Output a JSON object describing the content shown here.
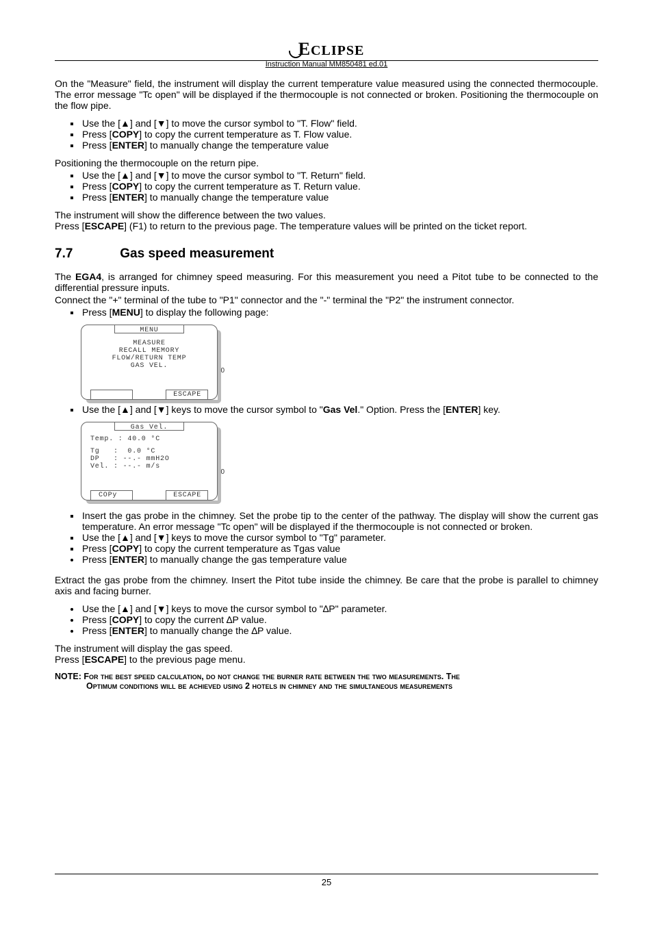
{
  "header": {
    "brand": "ECLIPSE",
    "manual_line": "Instruction Manual MM850481 ed.01"
  },
  "intro_para": "On the \"Measure\" field, the instrument will display the current temperature value measured using the connected thermocouple. The error message \"Tc open\" will be displayed if the thermocouple is not connected or broken. Positioning the thermocouple on the flow pipe.",
  "flow_list": [
    "Use the [▲] and [▼] to move the cursor symbol to \"T. Flow\" field.",
    "Press [COPY] to copy the current temperature as T. Flow value.",
    "Press [ENTER] to manually change the temperature value"
  ],
  "return_intro": "Positioning the thermocouple on the return pipe.",
  "return_list": [
    "Use the [▲] and [▼] to move the cursor symbol to \"T. Return\" field.",
    "Press [COPY] to copy the current temperature as T. Return value.",
    "Press [ENTER] to manually change the temperature value"
  ],
  "diff_para1": "The instrument will show the difference between the two values.",
  "diff_para2": "Press [ESCAPE] (F1) to return to the previous page. The temperature values will be printed on the ticket report.",
  "section": {
    "num": "7.7",
    "title": "Gas speed measurement"
  },
  "ega_para1": "The EGA4, is arranged for chimney speed measuring. For this measurement you need a Pitot tube to be connected to the differential pressure inputs.",
  "ega_para2": "Connect the \"+\" terminal of the tube to \"P1\" connector and the \"-\" terminal the \"P2\" the instrument connector.",
  "menu_prompt": "Press [MENU] to display the following page:",
  "lcd1": {
    "title": "MENU",
    "l1": "MEASURE",
    "l2": "RECALL MEMORY",
    "l3": "FLOW/RETURN TEMP",
    "l4": "GAS VEL.",
    "btn_right": "ESCAPE",
    "side": "0"
  },
  "gasvel_prompt_pre": "Use the [▲] and [▼] keys to move the cursor symbol to \"",
  "gasvel_prompt_bold": "Gas Vel",
  "gasvel_prompt_post": ".\" Option. Press the [ENTER] key.",
  "lcd2": {
    "title": "Gas Vel.",
    "l1": "Temp. : 40.0 °C",
    "l2": "Tg   :  0.0 °C",
    "l3": "DP   : --.- mmH2O",
    "l4": "Vel. : --.- m/s",
    "btn_left": "COPy",
    "btn_right": "ESCAPE",
    "side": "0"
  },
  "probe_list_sq": [
    "Insert the gas probe in the chimney. Set the probe tip to the center of the pathway. The display will show the current gas temperature. An error message \"Tc open\" will be displayed if the thermocouple is not connected or broken.",
    "Use the [▲] and [▼] keys to move the cursor symbol to \"Tg\" parameter.",
    "Press [COPY] to copy the current temperature as Tgas value"
  ],
  "probe_list_dot1": [
    "Press [ENTER] to manually change the gas temperature value"
  ],
  "extract_para": "Extract the gas probe from the chimney. Insert the Pitot tube inside the chimney. Be care that the probe is parallel to chimney axis and facing burner.",
  "dp_list": [
    "Use the [▲] and [▼] keys to move the cursor symbol to \"∆P\" parameter.",
    "Press [COPY] to copy the current ∆P value.",
    "Press [ENTER] to manually change the ∆P value."
  ],
  "speed_para1": "The instrument will display the gas speed.",
  "speed_para2": "Press [ESCAPE] to the previous page menu.",
  "note": {
    "lead": "NOTE: ",
    "body1": "For the best speed calculation, do not change the burner rate between the two measurements. The ",
    "body2": "Optimum conditions will be achieved using 2 hotels in chimney and the simultaneous measurements"
  },
  "footer": {
    "page": "25"
  }
}
